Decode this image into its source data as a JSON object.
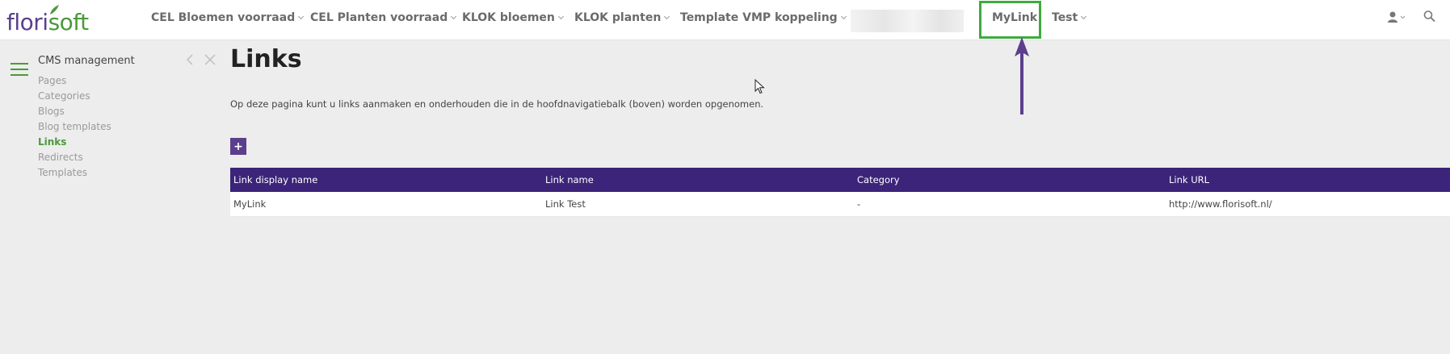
{
  "brand": {
    "logo_part1": "flori",
    "logo_part2": "soft"
  },
  "topnav": {
    "items": [
      {
        "label": "CEL Bloemen voorraad"
      },
      {
        "label": "CEL Planten voorraad"
      },
      {
        "label": "KLOK bloemen"
      },
      {
        "label": "KLOK planten"
      },
      {
        "label": "Template VMP koppeling"
      },
      {
        "label": "MyLink"
      },
      {
        "label": "Test"
      }
    ]
  },
  "sidebar": {
    "title": "CMS management",
    "items": [
      {
        "label": "Pages"
      },
      {
        "label": "Categories"
      },
      {
        "label": "Blogs"
      },
      {
        "label": "Blog templates"
      },
      {
        "label": "Links"
      },
      {
        "label": "Redirects"
      },
      {
        "label": "Templates"
      }
    ],
    "active_item": "Links"
  },
  "main": {
    "title": "Links",
    "intro": "Op deze pagina kunt u links aanmaken en onderhouden die in de hoofdnavigatiebalk (boven) worden opgenomen.",
    "add_label": "+",
    "table": {
      "headers": [
        "Link display name",
        "Link name",
        "Category",
        "Link URL"
      ],
      "rows": [
        [
          "MyLink",
          "Link Test",
          "-",
          "http://www.florisoft.nl/"
        ]
      ]
    }
  },
  "icons": {
    "user": "user-icon",
    "search": "search-icon",
    "menu": "hamburger-menu-icon",
    "back": "chevron-left-icon",
    "close": "close-icon"
  },
  "colors": {
    "brand_purple": "#5b3f8c",
    "brand_green": "#4a9a3a",
    "table_header": "#3b2479",
    "highlight_green": "#3faa3f",
    "annotation_arrow": "#5b3f8c"
  }
}
